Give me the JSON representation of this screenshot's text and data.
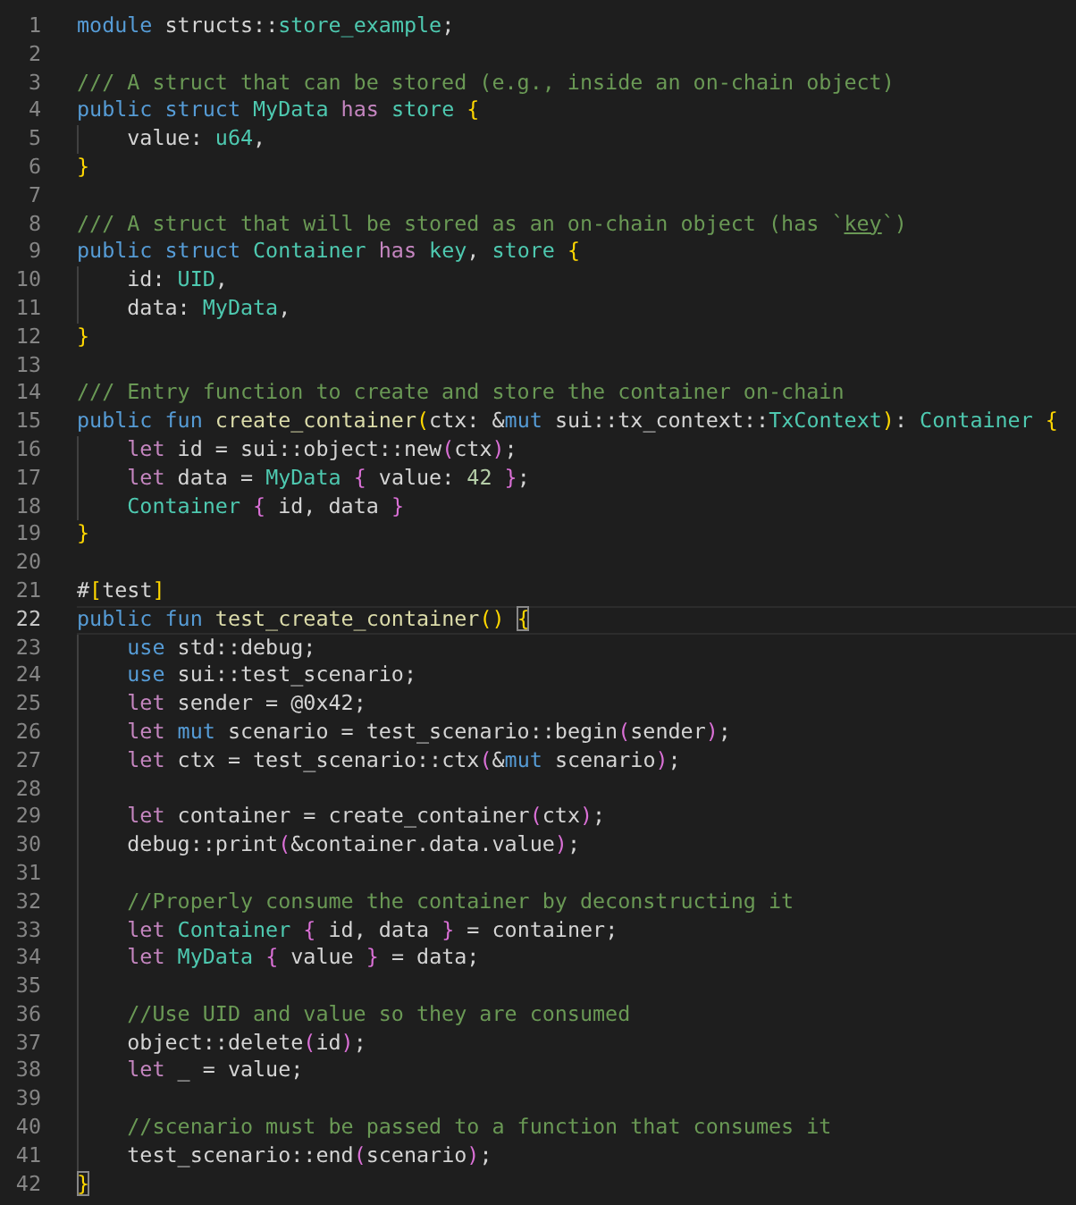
{
  "editor": {
    "lines": [
      {
        "number": "1",
        "tokens": [
          {
            "text": "module",
            "kind": "keyword"
          },
          {
            "text": " structs::",
            "kind": "plain"
          },
          {
            "text": "store_example",
            "kind": "type"
          },
          {
            "text": ";",
            "kind": "plain"
          }
        ]
      },
      {
        "number": "2"
      },
      {
        "number": "3",
        "tokens": [
          {
            "text": "/// A struct that can be stored (e.g., inside an on-chain object)",
            "kind": "comment"
          }
        ]
      },
      {
        "number": "4",
        "tokens": [
          {
            "text": "public struct ",
            "kind": "keyword"
          },
          {
            "text": "MyData",
            "kind": "type"
          },
          {
            "text": " has",
            "kind": "control"
          },
          {
            "text": " store",
            "kind": "type"
          },
          {
            "text": " {",
            "kind": "brace"
          }
        ]
      },
      {
        "number": "5",
        "guide": true,
        "tokens": [
          {
            "text": "    value: ",
            "kind": "plain"
          },
          {
            "text": "u64",
            "kind": "type"
          },
          {
            "text": ",",
            "kind": "plain"
          }
        ]
      },
      {
        "number": "6",
        "tokens": [
          {
            "text": "}",
            "kind": "brace"
          }
        ]
      },
      {
        "number": "7"
      },
      {
        "number": "8",
        "tokens": [
          {
            "text": "/// A struct that will be stored as an on-chain object (has `",
            "kind": "comment"
          },
          {
            "text": "key",
            "kind": "link"
          },
          {
            "text": "`)",
            "kind": "comment"
          }
        ]
      },
      {
        "number": "9",
        "tokens": [
          {
            "text": "public struct ",
            "kind": "keyword"
          },
          {
            "text": "Container",
            "kind": "type"
          },
          {
            "text": " has",
            "kind": "control"
          },
          {
            "text": " key",
            "kind": "type"
          },
          {
            "text": ", ",
            "kind": "plain"
          },
          {
            "text": "store",
            "kind": "type"
          },
          {
            "text": " {",
            "kind": "brace"
          }
        ]
      },
      {
        "number": "10",
        "guide": true,
        "tokens": [
          {
            "text": "    id: ",
            "kind": "plain"
          },
          {
            "text": "UID",
            "kind": "type"
          },
          {
            "text": ",",
            "kind": "plain"
          }
        ]
      },
      {
        "number": "11",
        "guide": true,
        "tokens": [
          {
            "text": "    data: ",
            "kind": "plain"
          },
          {
            "text": "MyData",
            "kind": "type"
          },
          {
            "text": ",",
            "kind": "plain"
          }
        ]
      },
      {
        "number": "12",
        "tokens": [
          {
            "text": "}",
            "kind": "brace"
          }
        ]
      },
      {
        "number": "13"
      },
      {
        "number": "14",
        "tokens": [
          {
            "text": "/// Entry function to create and store the container on-chain",
            "kind": "comment"
          }
        ]
      },
      {
        "number": "15",
        "tokens": [
          {
            "text": "public fun ",
            "kind": "keyword"
          },
          {
            "text": "create_container",
            "kind": "function"
          },
          {
            "text": "(",
            "kind": "brace"
          },
          {
            "text": "ctx: &",
            "kind": "plain"
          },
          {
            "text": "mut",
            "kind": "keyword"
          },
          {
            "text": " sui::tx_context::",
            "kind": "plain"
          },
          {
            "text": "TxContext",
            "kind": "type"
          },
          {
            "text": ")",
            "kind": "brace"
          },
          {
            "text": ": ",
            "kind": "plain"
          },
          {
            "text": "Container",
            "kind": "type"
          },
          {
            "text": " {",
            "kind": "brace"
          }
        ]
      },
      {
        "number": "16",
        "guide": true,
        "tokens": [
          {
            "text": "    let",
            "kind": "control"
          },
          {
            "text": " id = sui::object::new",
            "kind": "plain"
          },
          {
            "text": "(",
            "kind": "brace2"
          },
          {
            "text": "ctx",
            "kind": "plain"
          },
          {
            "text": ")",
            "kind": "brace2"
          },
          {
            "text": ";",
            "kind": "plain"
          }
        ]
      },
      {
        "number": "17",
        "guide": true,
        "tokens": [
          {
            "text": "    let",
            "kind": "control"
          },
          {
            "text": " data = ",
            "kind": "plain"
          },
          {
            "text": "MyData",
            "kind": "type"
          },
          {
            "text": " {",
            "kind": "brace2"
          },
          {
            "text": " value: ",
            "kind": "plain"
          },
          {
            "text": "42",
            "kind": "number"
          },
          {
            "text": " }",
            "kind": "brace2"
          },
          {
            "text": ";",
            "kind": "plain"
          }
        ]
      },
      {
        "number": "18",
        "guide": true,
        "tokens": [
          {
            "text": "    Container",
            "kind": "type"
          },
          {
            "text": " {",
            "kind": "brace2"
          },
          {
            "text": " id, data ",
            "kind": "plain"
          },
          {
            "text": "}",
            "kind": "brace2"
          }
        ]
      },
      {
        "number": "19",
        "tokens": [
          {
            "text": "}",
            "kind": "brace"
          }
        ]
      },
      {
        "number": "20"
      },
      {
        "number": "21",
        "tokens": [
          {
            "text": "#",
            "kind": "plain"
          },
          {
            "text": "[",
            "kind": "brace"
          },
          {
            "text": "test",
            "kind": "plain"
          },
          {
            "text": "]",
            "kind": "brace"
          }
        ]
      },
      {
        "number": "22",
        "current": true,
        "tokens": [
          {
            "text": "public fun ",
            "kind": "keyword"
          },
          {
            "text": "test_create_container",
            "kind": "function"
          },
          {
            "text": "() ",
            "kind": "brace"
          },
          {
            "text": "{",
            "kind": "match"
          }
        ]
      },
      {
        "number": "23",
        "guide": true,
        "tokens": [
          {
            "text": "    use",
            "kind": "keyword"
          },
          {
            "text": " std::debug;",
            "kind": "plain"
          }
        ]
      },
      {
        "number": "24",
        "guide": true,
        "tokens": [
          {
            "text": "    use",
            "kind": "keyword"
          },
          {
            "text": " sui::test_scenario;",
            "kind": "plain"
          }
        ]
      },
      {
        "number": "25",
        "guide": true,
        "tokens": [
          {
            "text": "    let",
            "kind": "control"
          },
          {
            "text": " sender = @0x42;",
            "kind": "plain"
          }
        ]
      },
      {
        "number": "26",
        "guide": true,
        "tokens": [
          {
            "text": "    let",
            "kind": "control"
          },
          {
            "text": " mut",
            "kind": "keyword"
          },
          {
            "text": " scenario = test_scenario::begin",
            "kind": "plain"
          },
          {
            "text": "(",
            "kind": "brace2"
          },
          {
            "text": "sender",
            "kind": "plain"
          },
          {
            "text": ")",
            "kind": "brace2"
          },
          {
            "text": ";",
            "kind": "plain"
          }
        ]
      },
      {
        "number": "27",
        "guide": true,
        "tokens": [
          {
            "text": "    let",
            "kind": "control"
          },
          {
            "text": " ctx = test_scenario::ctx",
            "kind": "plain"
          },
          {
            "text": "(",
            "kind": "brace2"
          },
          {
            "text": "&",
            "kind": "plain"
          },
          {
            "text": "mut",
            "kind": "keyword"
          },
          {
            "text": " scenario",
            "kind": "plain"
          },
          {
            "text": ")",
            "kind": "brace2"
          },
          {
            "text": ";",
            "kind": "plain"
          }
        ]
      },
      {
        "number": "28",
        "guide": true
      },
      {
        "number": "29",
        "guide": true,
        "tokens": [
          {
            "text": "    let",
            "kind": "control"
          },
          {
            "text": " container = create_container",
            "kind": "plain"
          },
          {
            "text": "(",
            "kind": "brace2"
          },
          {
            "text": "ctx",
            "kind": "plain"
          },
          {
            "text": ")",
            "kind": "brace2"
          },
          {
            "text": ";",
            "kind": "plain"
          }
        ]
      },
      {
        "number": "30",
        "guide": true,
        "tokens": [
          {
            "text": "    debug::print",
            "kind": "plain"
          },
          {
            "text": "(",
            "kind": "brace2"
          },
          {
            "text": "&container.data.value",
            "kind": "plain"
          },
          {
            "text": ")",
            "kind": "brace2"
          },
          {
            "text": ";",
            "kind": "plain"
          }
        ]
      },
      {
        "number": "31",
        "guide": true
      },
      {
        "number": "32",
        "guide": true,
        "tokens": [
          {
            "text": "    //Properly consume the container by deconstructing it",
            "kind": "comment"
          }
        ]
      },
      {
        "number": "33",
        "guide": true,
        "tokens": [
          {
            "text": "    let",
            "kind": "control"
          },
          {
            "text": " Container",
            "kind": "type"
          },
          {
            "text": " {",
            "kind": "brace2"
          },
          {
            "text": " id, data ",
            "kind": "plain"
          },
          {
            "text": "}",
            "kind": "brace2"
          },
          {
            "text": " = container;",
            "kind": "plain"
          }
        ]
      },
      {
        "number": "34",
        "guide": true,
        "tokens": [
          {
            "text": "    let",
            "kind": "control"
          },
          {
            "text": " MyData",
            "kind": "type"
          },
          {
            "text": " {",
            "kind": "brace2"
          },
          {
            "text": " value ",
            "kind": "plain"
          },
          {
            "text": "}",
            "kind": "brace2"
          },
          {
            "text": " = data;",
            "kind": "plain"
          }
        ]
      },
      {
        "number": "35",
        "guide": true
      },
      {
        "number": "36",
        "guide": true,
        "tokens": [
          {
            "text": "    //Use UID and value so they are consumed",
            "kind": "comment"
          }
        ]
      },
      {
        "number": "37",
        "guide": true,
        "tokens": [
          {
            "text": "    object::delete",
            "kind": "plain"
          },
          {
            "text": "(",
            "kind": "brace2"
          },
          {
            "text": "id",
            "kind": "plain"
          },
          {
            "text": ")",
            "kind": "brace2"
          },
          {
            "text": ";",
            "kind": "plain"
          }
        ]
      },
      {
        "number": "38",
        "guide": true,
        "tokens": [
          {
            "text": "    let",
            "kind": "control"
          },
          {
            "text": " _ = value;",
            "kind": "plain"
          }
        ]
      },
      {
        "number": "39",
        "guide": true
      },
      {
        "number": "40",
        "guide": true,
        "tokens": [
          {
            "text": "    //scenario must be passed to a function that consumes it",
            "kind": "comment"
          }
        ]
      },
      {
        "number": "41",
        "guide": true,
        "tokens": [
          {
            "text": "    test_scenario::end",
            "kind": "plain"
          },
          {
            "text": "(",
            "kind": "brace2"
          },
          {
            "text": "scenario",
            "kind": "plain"
          },
          {
            "text": ")",
            "kind": "brace2"
          },
          {
            "text": ";",
            "kind": "plain"
          }
        ]
      },
      {
        "number": "42",
        "tokens": [
          {
            "text": "}",
            "kind": "match"
          }
        ]
      }
    ]
  }
}
